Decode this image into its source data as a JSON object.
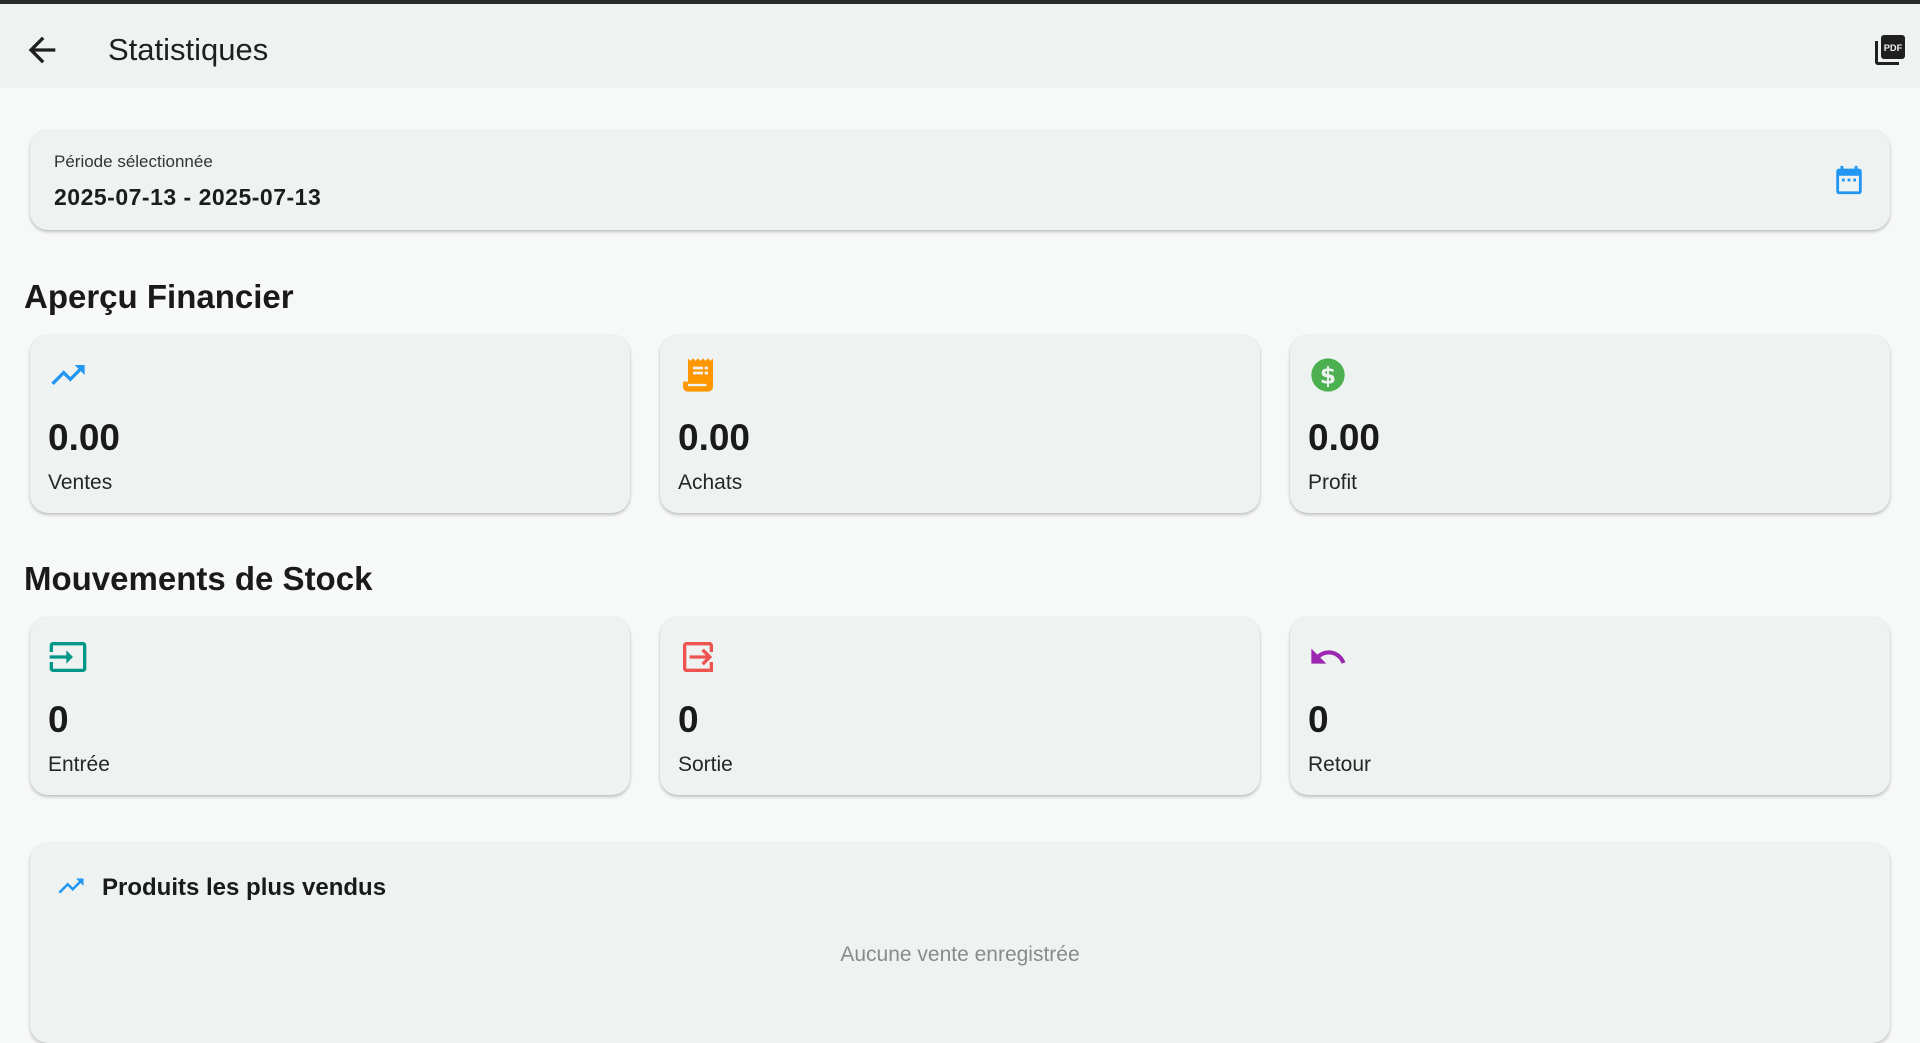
{
  "appbar": {
    "title": "Statistiques",
    "back_icon": "arrow-back-icon",
    "pdf_icon": "pdf-icon"
  },
  "period": {
    "label": "Période sélectionnée",
    "value": "2025-07-13 - 2025-07-13",
    "icon": "calendar-icon"
  },
  "financial": {
    "title": "Aperçu Financier",
    "cards": [
      {
        "value": "0.00",
        "label": "Ventes",
        "icon": "trending-up-icon",
        "color": "#2196f3"
      },
      {
        "value": "0.00",
        "label": "Achats",
        "icon": "receipt-icon",
        "color": "#ff9800"
      },
      {
        "value": "0.00",
        "label": "Profit",
        "icon": "dollar-icon",
        "color": "#4caf50"
      }
    ]
  },
  "stock": {
    "title": "Mouvements de Stock",
    "cards": [
      {
        "value": "0",
        "label": "Entrée",
        "icon": "login-icon",
        "color": "#009688"
      },
      {
        "value": "0",
        "label": "Sortie",
        "icon": "logout-icon",
        "color": "#ef5350"
      },
      {
        "value": "0",
        "label": "Retour",
        "icon": "undo-icon",
        "color": "#9c27b0"
      }
    ]
  },
  "top_products": {
    "title": "Produits les plus vendus",
    "empty": "Aucune vente enregistrée",
    "icon": "trending-up-icon"
  }
}
